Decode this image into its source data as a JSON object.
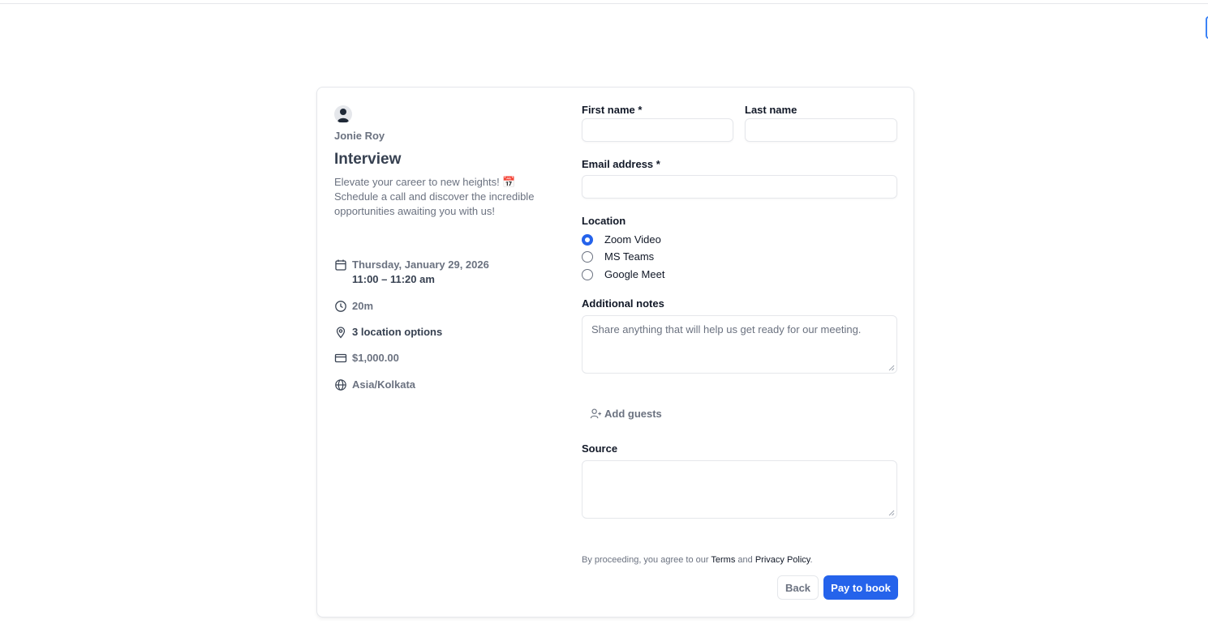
{
  "host": {
    "name": "Jonie Roy",
    "avatar_icon": "user-avatar-icon"
  },
  "event": {
    "title": "Interview",
    "description": "Elevate your career to new heights! 📅 Schedule a call and discover the incredible opportunities awaiting you with us!",
    "date": "Thursday, January 29, 2026",
    "time": "11:00 – 11:20 am",
    "duration": "20m",
    "locations": "3 location options",
    "price": "$1,000.00",
    "timezone": "Asia/Kolkata"
  },
  "form": {
    "first_name_label": "First name *",
    "last_name_label": "Last name",
    "email_label": "Email address *",
    "location_label": "Location",
    "location_options": [
      "Zoom Video",
      "MS Teams",
      "Google Meet"
    ],
    "location_selected": "Zoom Video",
    "notes_label": "Additional notes",
    "notes_placeholder": "Share anything that will help us get ready for our meeting.",
    "add_guests_label": "Add guests",
    "source_label": "Source"
  },
  "legal": {
    "prefix": "By proceeding, you agree to our ",
    "terms": "Terms",
    "and": " and ",
    "privacy": "Privacy Policy",
    "suffix": "."
  },
  "actions": {
    "back_label": "Back",
    "pay_label": "Pay to book"
  },
  "colors": {
    "accent": "#2563eb",
    "border": "#e5e7eb",
    "muted_text": "#6b7280"
  }
}
